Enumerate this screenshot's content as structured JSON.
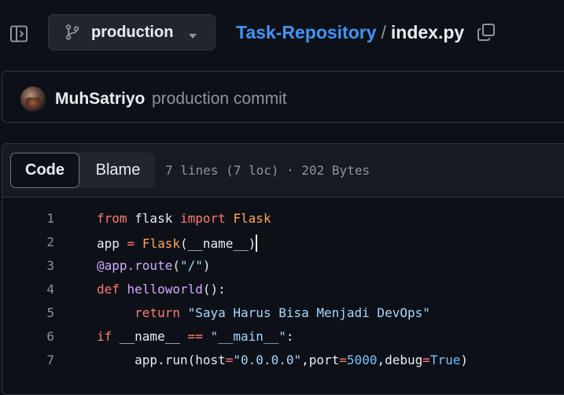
{
  "header": {
    "branch": "production",
    "repo": "Task-Repository",
    "separator": "/",
    "file": "index.py"
  },
  "commit": {
    "author": "MuhSatriyo",
    "message": "production commit"
  },
  "code_view": {
    "tabs": [
      {
        "label": "Code",
        "selected": true
      },
      {
        "label": "Blame",
        "selected": false
      }
    ],
    "file_info": "7 lines (7 loc) · 202 Bytes"
  },
  "lines": [
    {
      "n": "1",
      "tokens": [
        {
          "t": "from",
          "c": "kw"
        },
        {
          "t": " flask "
        },
        {
          "t": "import",
          "c": "kw"
        },
        {
          "t": " "
        },
        {
          "t": "Flask",
          "c": "cls"
        }
      ]
    },
    {
      "n": "2",
      "tokens": [
        {
          "t": "app "
        },
        {
          "t": "=",
          "c": "kw"
        },
        {
          "t": " "
        },
        {
          "t": "Flask",
          "c": "cls"
        },
        {
          "t": "(__name__)"
        }
      ],
      "caret": true
    },
    {
      "n": "3",
      "tokens": [
        {
          "t": "@app.route",
          "c": "fn"
        },
        {
          "t": "("
        },
        {
          "t": "\"/\"",
          "c": "str"
        },
        {
          "t": ")"
        }
      ]
    },
    {
      "n": "4",
      "tokens": [
        {
          "t": "def",
          "c": "kw"
        },
        {
          "t": " "
        },
        {
          "t": "helloworld",
          "c": "fn"
        },
        {
          "t": "():"
        }
      ]
    },
    {
      "n": "5",
      "tokens": [
        {
          "t": "     "
        },
        {
          "t": "return",
          "c": "kw"
        },
        {
          "t": " "
        },
        {
          "t": "\"Saya Harus Bisa Menjadi DevOps\"",
          "c": "str"
        }
      ]
    },
    {
      "n": "6",
      "tokens": [
        {
          "t": "if",
          "c": "kw"
        },
        {
          "t": " __name__ "
        },
        {
          "t": "==",
          "c": "kw"
        },
        {
          "t": " "
        },
        {
          "t": "\"__main__\"",
          "c": "str"
        },
        {
          "t": ":"
        }
      ]
    },
    {
      "n": "7",
      "tokens": [
        {
          "t": "     app.run(host"
        },
        {
          "t": "=",
          "c": "kw"
        },
        {
          "t": "\"0.0.0.0\"",
          "c": "str"
        },
        {
          "t": ",port"
        },
        {
          "t": "=",
          "c": "kw"
        },
        {
          "t": "5000",
          "c": "num"
        },
        {
          "t": ",debug"
        },
        {
          "t": "=",
          "c": "kw"
        },
        {
          "t": "True",
          "c": "num"
        },
        {
          "t": ")"
        }
      ]
    }
  ]
}
